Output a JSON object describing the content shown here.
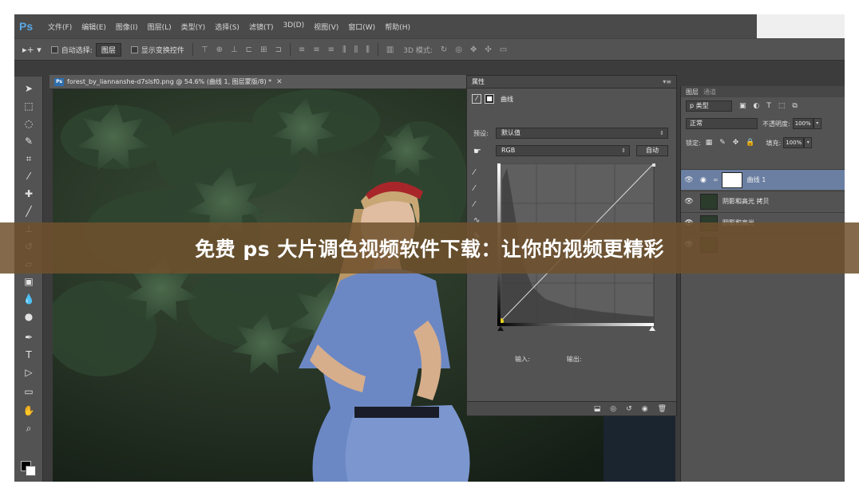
{
  "app": {
    "logo": "Ps",
    "menu": [
      "文件(F)",
      "编辑(E)",
      "图像(I)",
      "图层(L)",
      "类型(Y)",
      "选择(S)",
      "滤镜(T)",
      "3D(D)",
      "视图(V)",
      "窗口(W)",
      "帮助(H)"
    ]
  },
  "options_bar": {
    "auto_select_label": "自动选择:",
    "auto_select_value": "图层",
    "show_transform_label": "显示变换控件",
    "mode_3d_label": "3D 模式:"
  },
  "document": {
    "badge": "Ps",
    "title": "forest_by_liannanshe-d7slsf0.png @ 54.6% (曲线 1, 图层蒙版/8) *"
  },
  "properties": {
    "tab": "属性",
    "panel_title": "曲线",
    "preset_label": "预设:",
    "preset_value": "默认值",
    "channel_value": "RGB",
    "auto_button": "自动",
    "input_label": "输入:",
    "output_label": "输出:"
  },
  "layers": {
    "tab_layers": "图层",
    "tab_channels": "通道",
    "filter_value": "p 类型",
    "blend_mode": "正常",
    "opacity_label": "不透明度:",
    "opacity_value": "100%",
    "lock_label": "锁定:",
    "fill_label": "填充:",
    "fill_value": "100%",
    "items": [
      {
        "name": "曲线 1"
      },
      {
        "name": "阴影和高光 拷贝"
      },
      {
        "name": "阴影和高光"
      }
    ]
  },
  "banner": {
    "text": "免费 ps 大片调色视频软件下载：让你的视频更精彩"
  },
  "colors": {
    "banner_bg": "#70522d",
    "ui_dark": "#3c3c3c",
    "panel": "#535353",
    "active_layer": "#6b7fa2"
  },
  "icons": [
    "move-icon",
    "marquee-icon",
    "lasso-icon",
    "quick-select-icon",
    "crop-icon",
    "eyedropper-icon",
    "healing-icon",
    "brush-icon",
    "stamp-icon",
    "history-brush-icon",
    "eraser-icon",
    "gradient-icon",
    "blur-icon",
    "dodge-icon",
    "pen-icon",
    "type-icon",
    "path-select-icon",
    "rectangle-icon",
    "hand-icon",
    "zoom-icon",
    "eye-icon",
    "trash-icon"
  ]
}
